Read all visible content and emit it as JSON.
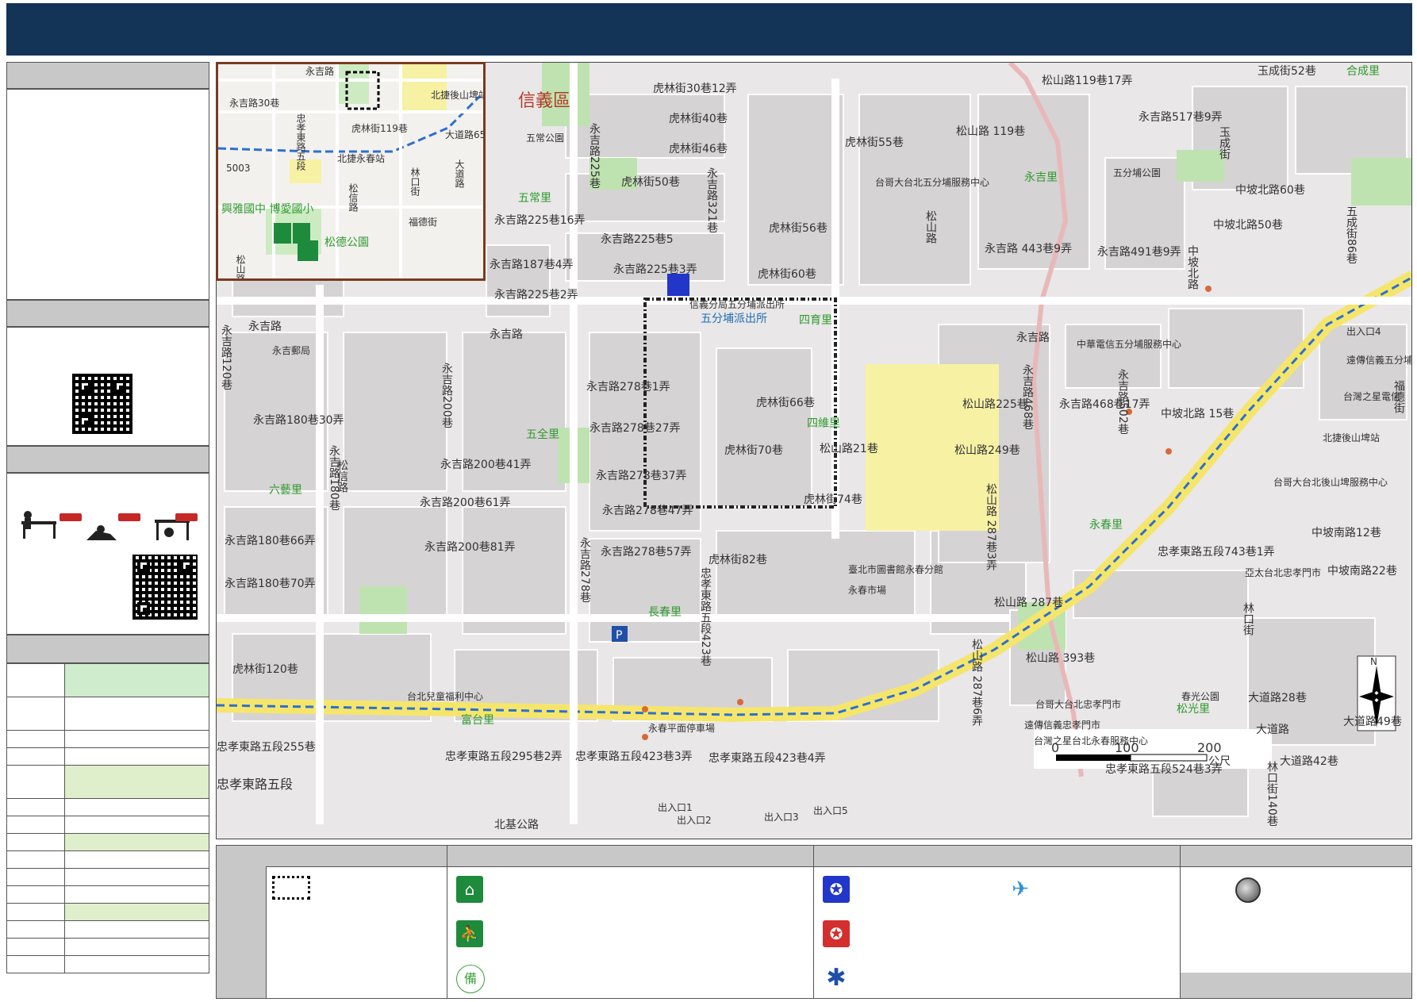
{
  "map": {
    "district_label": "信義區",
    "scale": {
      "ticks": [
        "0",
        "100",
        "200"
      ],
      "unit": "公尺"
    },
    "north_label": "N",
    "street_labels": [
      "虎林街30巷12弄",
      "虎林街40巷",
      "虎林街46巷",
      "虎林街50巷",
      "虎林街55巷",
      "虎林街56巷",
      "虎林街60巷",
      "虎林街66巷",
      "虎林街70巷",
      "虎林街74巷",
      "虎林街82巷",
      "虎林街120巷",
      "虎林街",
      "永吉路",
      "永吉路225巷16弄",
      "永吉路225巷5",
      "永吉路225巷3弄",
      "永吉路225巷2弄",
      "永吉路187巷4弄",
      "永吉路278巷1弄",
      "永吉路278巷27弄",
      "永吉路278巷37弄",
      "永吉路278巷47弄",
      "永吉路278巷57弄",
      "永吉路200巷41弄",
      "永吉路200巷61弄",
      "永吉路200巷81弄",
      "永吉路180巷30弄",
      "永吉路180巷66弄",
      "永吉路180巷70弄",
      "永吉路120巷",
      "永吉路180巷",
      "永吉路200巷",
      "永吉路278巷",
      "永吉路225巷",
      "永吉路321巷",
      "永吉路 443巷9弄",
      "永吉路491巷9弄",
      "永吉路517巷9弄",
      "永吉路468巷17弄",
      "永吉路468巷",
      "永吉路502巷",
      "松山路",
      "松山路 119巷",
      "松山路119巷17弄",
      "松山路225巷",
      "松山路249巷",
      "松山路 287巷3弄",
      "松山路 287巷",
      "松山路 393巷",
      "松山路 287巷6弄",
      "松山路21巷",
      "松信路",
      "忠孝東路五段",
      "忠孝東路五段255巷",
      "忠孝東路五段295巷2弄",
      "忠孝東路五段423巷3弄",
      "忠孝東路五段423巷4弄",
      "忠孝東路五段423巷",
      "忠孝東路五段743巷1弄",
      "忠孝東路五段524巷3弄",
      "北基公路",
      "中坡北路",
      "中坡北路60巷",
      "中坡北路50巷",
      "中坡北路 15巷",
      "中坡南路12巷",
      "中坡南路22巷",
      "玉成街",
      "玉成街52巷",
      "五成街86巷",
      "福德街",
      "林口街",
      "林口街140巷",
      "大道路",
      "大道路28巷",
      "大道路42巷",
      "大道路49巷"
    ],
    "village_labels": [
      "五常里",
      "五全里",
      "六藝里",
      "長春里",
      "富台里",
      "四維里",
      "四育里",
      "永吉里",
      "永春里",
      "合成里",
      "松光里"
    ],
    "poi_labels": [
      "信義分局五分埔派出所",
      "五分埔派出所",
      "永吉郵局",
      "永春市場",
      "永春平面停車場",
      "台北兒童福利中心",
      "臺北市圖書館永春分館",
      "五常公園",
      "五分埔公園",
      "春光公園",
      "台哥大台北五分埔服務中心",
      "中華電信五分埔服務中心",
      "遠傳信義五分埔",
      "台灣之星電信",
      "北捷後山埤站",
      "台哥大台北後山埤服務中心",
      "亞太台北忠孝門市",
      "台哥大台北忠孝門市",
      "遠傳信義忠孝門市",
      "台灣之星台北永春服務中心"
    ],
    "exit_labels": [
      "出入口1",
      "出入口2",
      "出入口3",
      "出入口4",
      "出入口5"
    ]
  },
  "inset": {
    "labels": [
      "永吉路",
      "北捷後山埤站",
      "永吉路30巷",
      "虎林街119巷",
      "忠孝東路五段",
      "北捷永春站",
      "大道路65巷",
      "大道路",
      "林口街",
      "福德街",
      "松信路",
      "松山路",
      "5003"
    ],
    "school_labels": "興雅國中 博愛國小",
    "park_label": "松德公園"
  },
  "colors": {
    "title_bar": "#143457",
    "main_road": "#f5e66b",
    "mrt_line": "#2d6fd1",
    "district_border": "#8b2e1c",
    "village_text": "#2e9a2e"
  }
}
